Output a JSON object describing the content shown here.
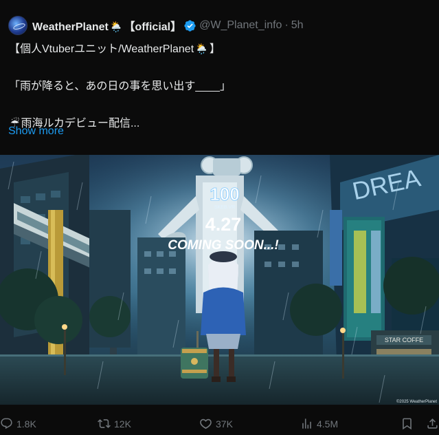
{
  "header": {
    "display_name": "WeatherPlanet",
    "display_name_emoji": "🌦️",
    "official_tag": "【official】",
    "handle": "@W_Planet_info",
    "dot": "·",
    "time": "5h",
    "verified_color": "#1d9bf0"
  },
  "tweet": {
    "line1_prefix": "【個人Vtuberユニット/WeatherPlanet",
    "line1_emoji": "🌦️",
    "line1_suffix": "】",
    "line2": "「雨が降ると、あの日の事を思い出す____」",
    "line3_emoji": "☔",
    "line3_text": "雨海ルカデビュー配信...",
    "show_more": "Show more"
  },
  "media": {
    "logo_text": "100",
    "logo_sub": "SKEB.VR",
    "date": "4.27",
    "coming_soon": "COMING SOON...!",
    "sign_right": "DREA",
    "store_sign": "STAR COFFE",
    "copyright": "©2025 WeatherPlanet"
  },
  "actions": {
    "reply_count": "1.8K",
    "repost_count": "12K",
    "like_count": "37K",
    "views_count": "4.5M",
    "icon_color": "#71767b"
  }
}
